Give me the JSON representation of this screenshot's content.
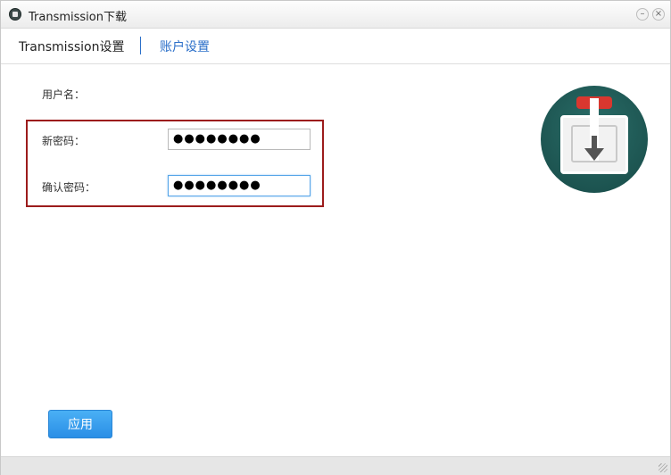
{
  "window": {
    "title": "Transmission下载",
    "minimize_glyph": "–",
    "close_glyph": "×"
  },
  "tabs": [
    {
      "label": "Transmission设置",
      "active": true
    },
    {
      "label": "账户设置",
      "active": false
    }
  ],
  "form": {
    "username_label": "用户名：",
    "new_password_label": "新密码：",
    "new_password_value": "●●●●●●●●",
    "confirm_password_label": "确认密码：",
    "confirm_password_value": "●●●●●●●●"
  },
  "apply_button": "应用",
  "colors": {
    "accent": "#2b6fc9",
    "button": "#2a8ee6",
    "highlight": "#9c1c1c",
    "logo_bg": "#174a47"
  },
  "icons": {
    "app": "transmission-icon",
    "logo": "transmission-logo-icon"
  }
}
